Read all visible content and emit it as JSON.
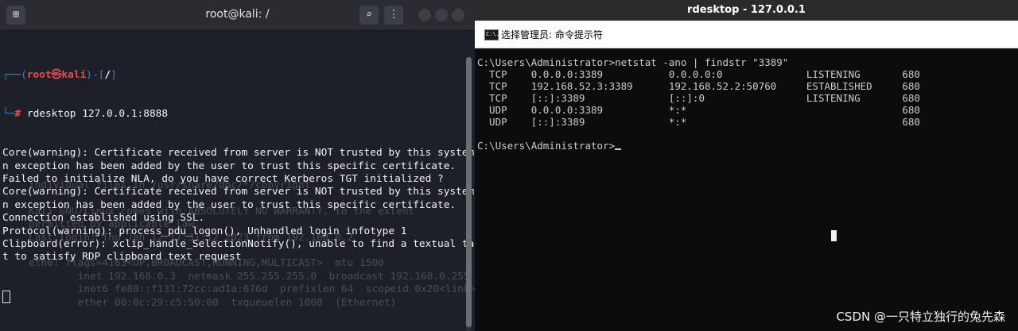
{
  "left_window": {
    "title": "root@kali: /",
    "buttons": {
      "new_tab_icon": "terminal-icon",
      "search_icon": "search-icon",
      "menu_icon": "menu-icon"
    },
    "prompt": {
      "user": "root",
      "at": "㉿",
      "host": "kali",
      "dir": "/",
      "hash": "#",
      "command": "rdesktop 127.0.0.1:8888"
    },
    "output": [
      "Core(warning): Certificate received from server is NOT trusted by this system, a",
      "n exception has been added by the user to trust this specific certificate.",
      "Failed to initialize NLA, do you have correct Kerberos TGT initialized ?",
      "Core(warning): Certificate received from server is NOT trusted by this system, a",
      "n exception has been added by the user to trust this specific certificate.",
      "Connection established using SSL.",
      "Protocol(warning): process_pdu_logon(), Unhandled login infotype 1",
      "Clipboard(error): xclip_handle_SelectionNotify(), unable to find a textual targe",
      "t to satisfy RDP clipboard text request"
    ],
    "ghost_text": [
      "individual files in /usr/share/doc/*/copyright.",
      "",
      "Kali GNU/Linux comes with ABSOLUTELY NO WARRANTY, to the extent",
      "permitted by applicable law.",
      "Last login: Thu Jan 12 17:31:12 2023 from 192.168.0.2",
      "",
      "eth0: flags=4163<UP,BROADCAST,RUNNING,MULTICAST>  mtu 1500",
      "        inet 192.168.0.3  netmask 255.255.255.0  broadcast 192.168.0.255",
      "        inet6 fe80::f131:72cc:ad1a:676d  prefixlen 64  scopeid 0x20<link>",
      "        ether 00:0c:29:c5:50:00  txqueuelen 1000  (Ethernet)"
    ]
  },
  "right_window": {
    "title": "rdesktop - 127.0.0.1",
    "cmd_title": "选择管理员: 命令提示符",
    "cmd_icon_label": "C:\\.",
    "lines": [
      "C:\\Users\\Administrator>netstat -ano | findstr \"3389\"",
      "  TCP    0.0.0.0:3389           0.0.0.0:0              LISTENING       680",
      "  TCP    192.168.52.3:3389      192.168.52.2:50760     ESTABLISHED     680",
      "  TCP    [::]:3389              [::]:0                 LISTENING       680",
      "  UDP    0.0.0.0:3389           *:*                                    680",
      "  UDP    [::]:3389              *:*                                    680",
      "",
      "C:\\Users\\Administrator>"
    ]
  },
  "watermark": "CSDN @一只特立独行的兔先森"
}
